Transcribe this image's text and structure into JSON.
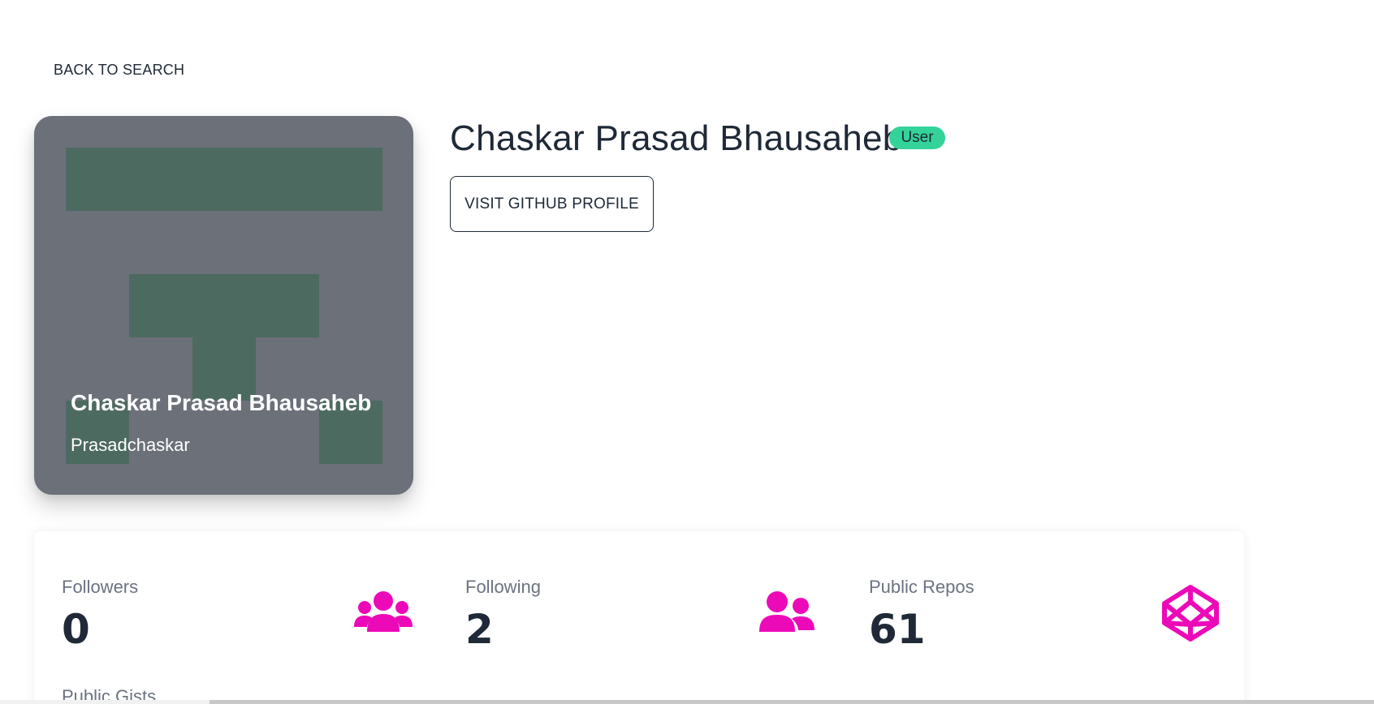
{
  "nav": {
    "back_label": "BACK TO SEARCH"
  },
  "avatar": {
    "name": "Chaskar Prasad Bhausaheb",
    "login": "Prasadchaskar"
  },
  "profile": {
    "name": "Chaskar Prasad Bhausaheb",
    "type_badge": "User",
    "visit_label": "VISIT GITHUB PROFILE"
  },
  "stats": [
    {
      "label": "Followers",
      "value": "0",
      "icon": "users-icon"
    },
    {
      "label": "Following",
      "value": "2",
      "icon": "user-friends-icon"
    },
    {
      "label": "Public Repos",
      "value": "61",
      "icon": "codepen-icon"
    },
    {
      "label": "Public Gists",
      "value": "",
      "icon": "gist-icon"
    }
  ],
  "colors": {
    "accent": "#ec0ab8",
    "badge": "#34d399",
    "avatar_bg": "#6b7079",
    "avatar_block": "#4d6a60",
    "text": "#1f2937",
    "muted": "#6b7280"
  }
}
